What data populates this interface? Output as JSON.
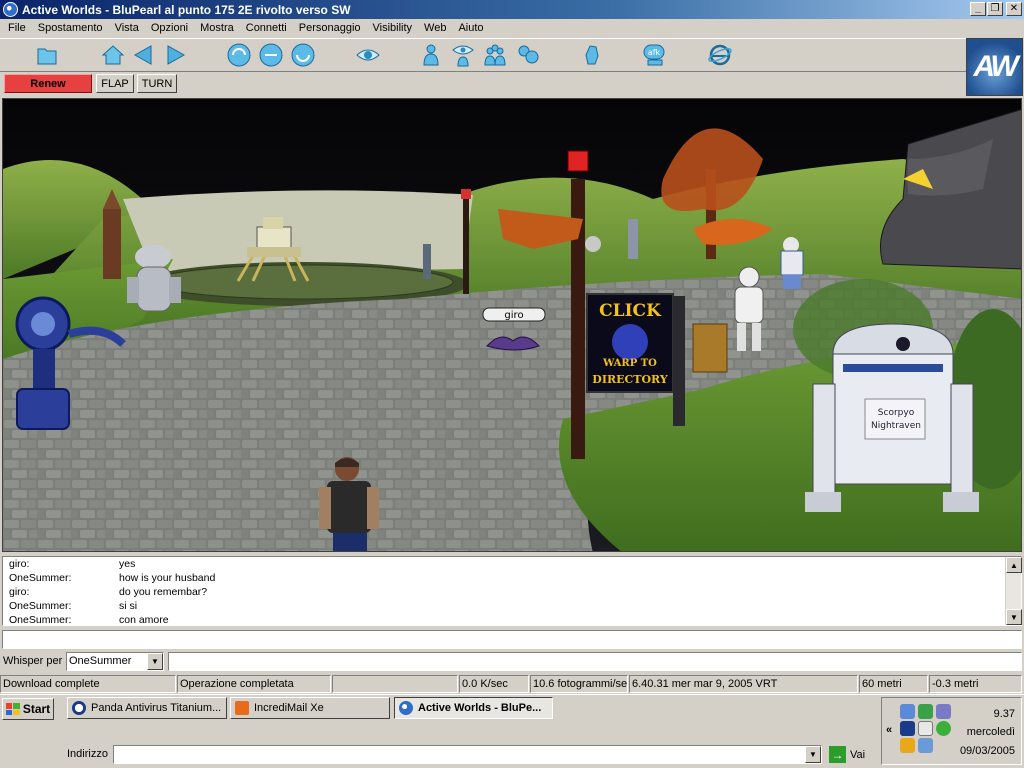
{
  "window": {
    "title": "Active Worlds - BluPearl al punto 175 2E rivolto verso SW",
    "controls": {
      "minimize": "_",
      "maximize": "❐",
      "close": "✕"
    }
  },
  "menu": [
    "File",
    "Spostamento",
    "Vista",
    "Opzioni",
    "Mostra",
    "Connetti",
    "Personaggio",
    "Visibility",
    "Web",
    "Aiuto"
  ],
  "toolbar": {
    "icons": [
      "folder-icon",
      "home-icon",
      "back-icon",
      "forward-icon",
      "orbit-left-icon",
      "orbit-icon",
      "orbit-right-icon",
      "eye-icon",
      "user-icon",
      "user-view-icon",
      "users-icon",
      "contacts-icon",
      "gesture-icon",
      "afk-icon",
      "internet-icon"
    ],
    "afk_label": "afk",
    "logo": "AW"
  },
  "actions": {
    "renew": "Renew",
    "flap": "FLAP",
    "turn": "TURN"
  },
  "scene": {
    "avatar_label": "giro",
    "sign_text": [
      "CLICK",
      "WARP TO",
      "DIRECTORY"
    ],
    "robot_label": [
      "Scorpyo",
      "Nightraven"
    ]
  },
  "chat": [
    {
      "name": "giro:",
      "message": "yes"
    },
    {
      "name": "OneSummer:",
      "message": "how is your husband"
    },
    {
      "name": "giro:",
      "message": "do you remembar?"
    },
    {
      "name": "OneSummer:",
      "message": " si si"
    },
    {
      "name": "OneSummer:",
      "message": " con amore"
    }
  ],
  "whisper": {
    "label": "Whisper per",
    "selected": "OneSummer"
  },
  "status": {
    "download": "Download complete",
    "operation": "Operazione completata",
    "empty": "",
    "speed": "0.0 K/sec",
    "fps": "10.6 fotogrammi/sec",
    "datetime": "6.40.31 mer mar 9, 2005 VRT",
    "distance": "60 metri",
    "altitude": "-0.3 metri"
  },
  "taskbar": {
    "start": "Start",
    "tasks": [
      {
        "label": "Panda Antivirus Titanium...",
        "active": false
      },
      {
        "label": "IncrediMail Xe",
        "active": false
      },
      {
        "label": "Active Worlds - BluPe...",
        "active": true
      }
    ],
    "address_label": "Indirizzo",
    "address_value": "",
    "go_label": "Vai",
    "tray_chevron": "«",
    "clock": {
      "time": "9.37",
      "day": "mercoledì",
      "date": "09/03/2005"
    }
  },
  "colors": {
    "titlebar": "#0a246a",
    "renew": "#e64040",
    "face": "#d4d0c8"
  }
}
